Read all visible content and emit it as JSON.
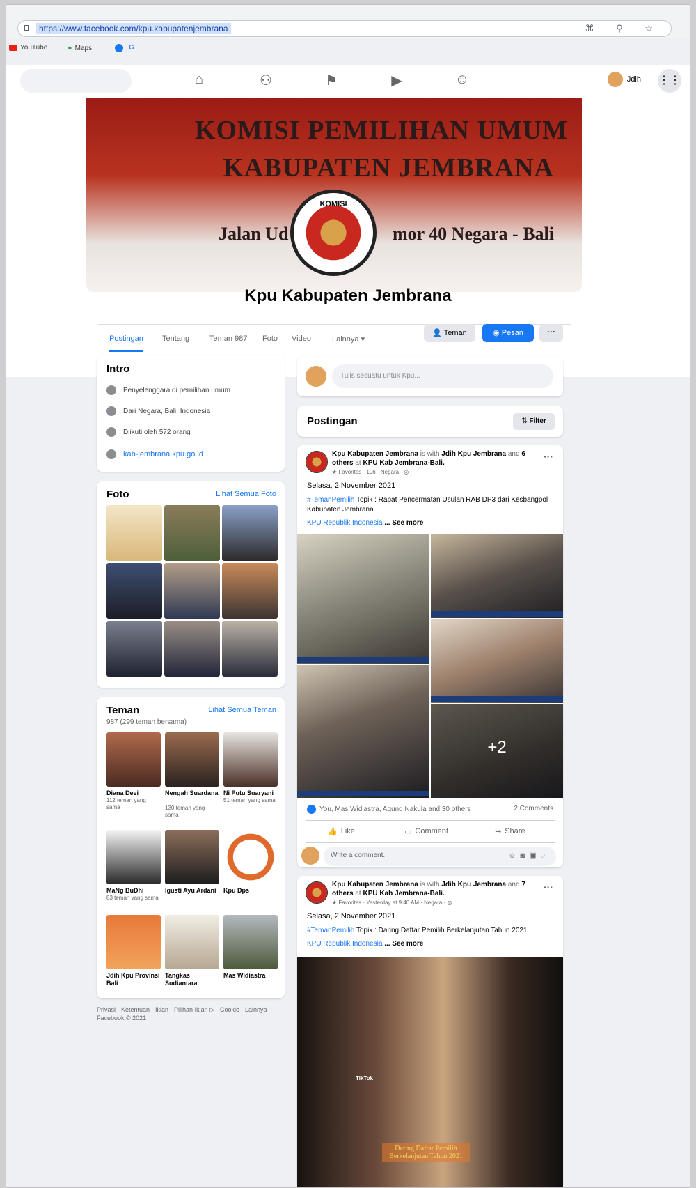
{
  "browser": {
    "url": "https://www.facebook.com/kpu.kabupatenjembrana",
    "bookmarks": [
      "YouTube",
      "Maps"
    ]
  },
  "nav": {
    "account_name": "Jdih"
  },
  "cover": {
    "line1": "KOMISI PEMILIHAN UMUM",
    "line2": "KABUPATEN JEMBRANA",
    "line3a": "Jalan Ud",
    "line3b": "mor 40 Negara - Bali",
    "logo_text": "KOMISI"
  },
  "page": {
    "name": "Kpu Kabupaten Jembrana"
  },
  "tabs": [
    "Postingan",
    "Tentang",
    "Teman 987",
    "Foto",
    "Video",
    "Lainnya ▾"
  ],
  "actions": {
    "friend": "Teman",
    "message": "Pesan",
    "more": "···"
  },
  "intro": {
    "title": "Intro",
    "items": [
      "Penyelenggara di pemilihan umum",
      "Dari Negara, Bali, Indonesia",
      "Diikuti oleh 572 orang",
      "kab-jembrana.kpu.go.id"
    ]
  },
  "photos": {
    "title": "Foto",
    "see_all": "Lihat Semua Foto"
  },
  "friends": {
    "title": "Teman",
    "see_all": "Lihat Semua Teman",
    "count": "987 (299 teman bersama)",
    "list": [
      {
        "name": "Diana Devi",
        "sub": "112 teman yang sama"
      },
      {
        "name": "Nengah Suardana",
        "sub": "130 teman yang sama"
      },
      {
        "name": "Ni Putu Suaryani",
        "sub": "51 teman yang sama"
      },
      {
        "name": "MaNg BuDhi",
        "sub": "83 teman yang sama"
      },
      {
        "name": "Igusti Ayu Ardani",
        "sub": ""
      },
      {
        "name": "Kpu Dps",
        "sub": ""
      },
      {
        "name": "Jdih Kpu Provinsi Bali",
        "sub": ""
      },
      {
        "name": "Tangkas Sudiantara",
        "sub": ""
      },
      {
        "name": "Mas Widiastra",
        "sub": ""
      }
    ]
  },
  "footer": "Privasi · Ketentuan · Iklan · Pilihan Iklan ▷ · Cookie · Lainnya · Facebook © 2021",
  "composer": {
    "placeholder": "Tulis sesuatu untuk Kpu..."
  },
  "posts_header": {
    "title": "Postingan",
    "filter": "Filter"
  },
  "post1": {
    "author": "Kpu Kabupaten Jembrana",
    "with_text": "is with",
    "tagged": "Jdih Kpu Jembrana",
    "and": "and",
    "others": "6 others",
    "at": "at",
    "place": "KPU Kab Jembrana-Bali.",
    "meta": "★ Favorites · 19h · Negara · ◎",
    "date": "Selasa, 2 November 2021",
    "hashtag": "#TemanPemilih",
    "body": "Topik : Rapat Pencermatan Usulan RAB DP3 dari Kesbangpol Kabupaten Jembrana",
    "source": "KPU Republik Indonesia",
    "see_more": "... See more",
    "more_photos": "+2",
    "reactions": "You, Mas Widiastra, Agung Nakula and 30 others",
    "comments": "2 Comments",
    "like": "Like",
    "comment": "Comment",
    "share": "Share",
    "write_comment": "Write a comment..."
  },
  "post2": {
    "author": "Kpu Kabupaten Jembrana",
    "with_text": "is with",
    "tagged": "Jdih Kpu Jembrana",
    "and": "and",
    "others": "7 others",
    "at": "at",
    "place": "KPU Kab Jembrana-Bali.",
    "meta": "★ Favorites · Yesterday at 9:40 AM · Negara · ◎",
    "date": "Selasa, 2 November 2021",
    "hashtag": "#TemanPemilih",
    "body": "Topik : Daring Daftar Pemilih Berkelanjutan Tahun 2021",
    "source": "KPU Republik Indonesia",
    "see_more": "... See more",
    "video_caption": "Daring Daftar Pemilih Berkelanjutan Tahun 2021",
    "tiktok": "TikTok"
  }
}
